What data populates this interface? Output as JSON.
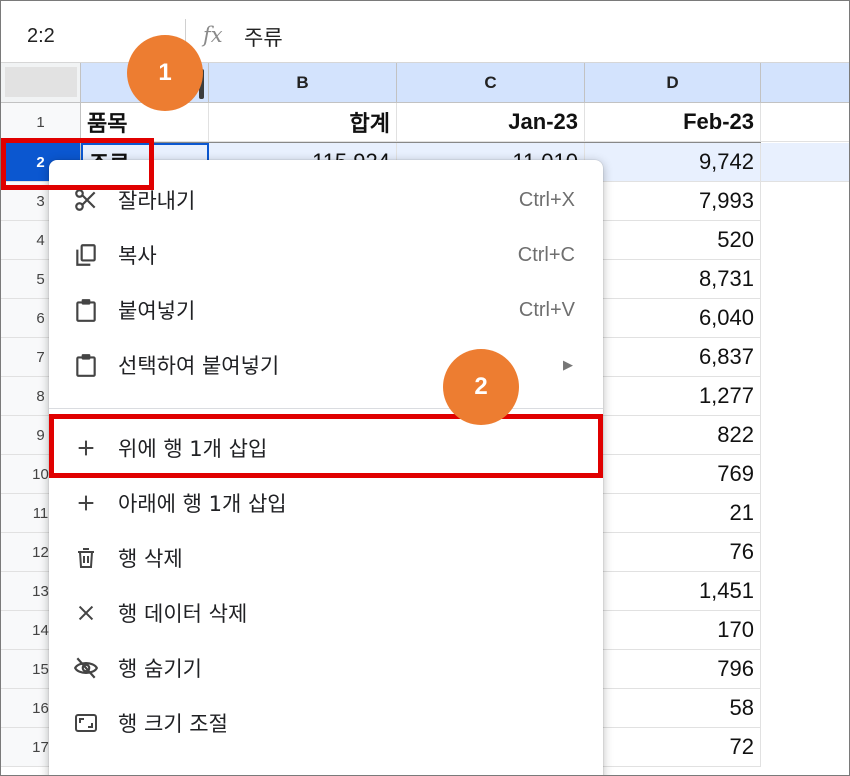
{
  "formula_bar": {
    "cell_ref": "2:2",
    "fx_label": "fx",
    "value": "주류"
  },
  "columns": [
    {
      "letter": "",
      "label": ""
    },
    {
      "letter": "B",
      "label": "B"
    },
    {
      "letter": "C",
      "label": "C"
    },
    {
      "letter": "D",
      "label": "D"
    },
    {
      "letter": "",
      "label": ""
    }
  ],
  "row_numbers": [
    "1",
    "2",
    "3",
    "4",
    "5",
    "6",
    "7",
    "8",
    "9",
    "10",
    "11",
    "12",
    "13",
    "14",
    "15",
    "16",
    "17"
  ],
  "header_row": {
    "a": "품목",
    "b": "합계",
    "c": "Jan-23",
    "d": "Feb-23"
  },
  "row2": {
    "a": "주류",
    "b": "115,924",
    "c": "11,010",
    "d": "9,742"
  },
  "col_d_values": [
    "7,993",
    "520",
    "8,731",
    "6,040",
    "6,837",
    "1,277",
    "822",
    "769",
    "21",
    "76",
    "1,451",
    "170",
    "796",
    "58",
    "72"
  ],
  "context_menu": {
    "items": [
      {
        "icon": "scissors-icon",
        "label": "잘라내기",
        "shortcut": "Ctrl+X"
      },
      {
        "icon": "copy-icon",
        "label": "복사",
        "shortcut": "Ctrl+C"
      },
      {
        "icon": "clipboard-icon",
        "label": "붙여넣기",
        "shortcut": "Ctrl+V"
      },
      {
        "icon": "clipboard-icon",
        "label": "선택하여 붙여넣기",
        "submenu_arrow": "▶"
      },
      {
        "icon": "plus-icon",
        "label": "위에 행 1개 삽입"
      },
      {
        "icon": "plus-icon",
        "label": "아래에 행 1개 삽입"
      },
      {
        "icon": "trash-icon",
        "label": "행 삭제"
      },
      {
        "icon": "close-icon",
        "label": "행 데이터 삭제"
      },
      {
        "icon": "eye-off-icon",
        "label": "행 숨기기"
      },
      {
        "icon": "resize-icon",
        "label": "행 크기 조절"
      }
    ]
  },
  "annotations": {
    "badge1": "1",
    "badge2": "2"
  },
  "colors": {
    "selected_header": "#0b57d0",
    "column_header": "#d3e3fd",
    "annotation_red": "#e00000",
    "badge_orange": "#ed7d31"
  }
}
